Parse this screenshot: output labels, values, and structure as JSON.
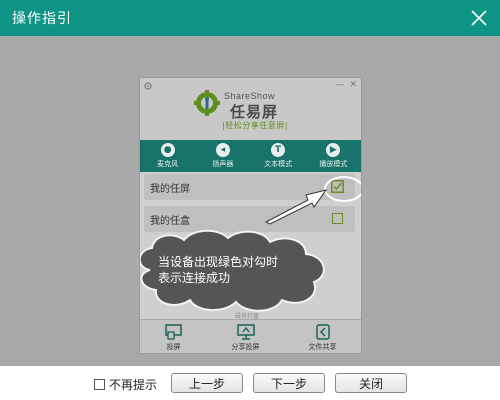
{
  "window": {
    "title": "操作指引",
    "close_icon": "close-icon"
  },
  "app": {
    "brand_en": "ShareShow",
    "brand_cn": "任易屏",
    "slogan": "|轻松分享任意屏|",
    "toolbar": [
      {
        "label": "麦克风",
        "icon": "microphone-icon"
      },
      {
        "label": "扬声器",
        "icon": "speaker-icon"
      },
      {
        "label": "文本模式",
        "icon": "text-mode-icon"
      },
      {
        "label": "播放模式",
        "icon": "play-mode-icon"
      }
    ],
    "devices": [
      {
        "label": "我的任屏",
        "status": "connected"
      },
      {
        "label": "我的任盒",
        "status": "unchecked"
      }
    ],
    "hint_text_line1": "当设备出现绿色对勾时",
    "hint_text_line2": "表示连接成功",
    "small_text": "磁铁打盘",
    "bottom_tabs": [
      {
        "label": "投屏",
        "icon": "cast-screen-icon"
      },
      {
        "label": "分享投屏",
        "icon": "share-cast-icon"
      },
      {
        "label": "文件共享",
        "icon": "file-share-icon"
      }
    ]
  },
  "footer": {
    "checkbox_label": "不再提示",
    "checkbox_checked": false,
    "prev_label": "上一步",
    "next_label": "下一步",
    "close_label": "关闭"
  },
  "colors": {
    "accent": "#0f9585",
    "toolbar": "#18736b",
    "check": "#6b8e23"
  }
}
